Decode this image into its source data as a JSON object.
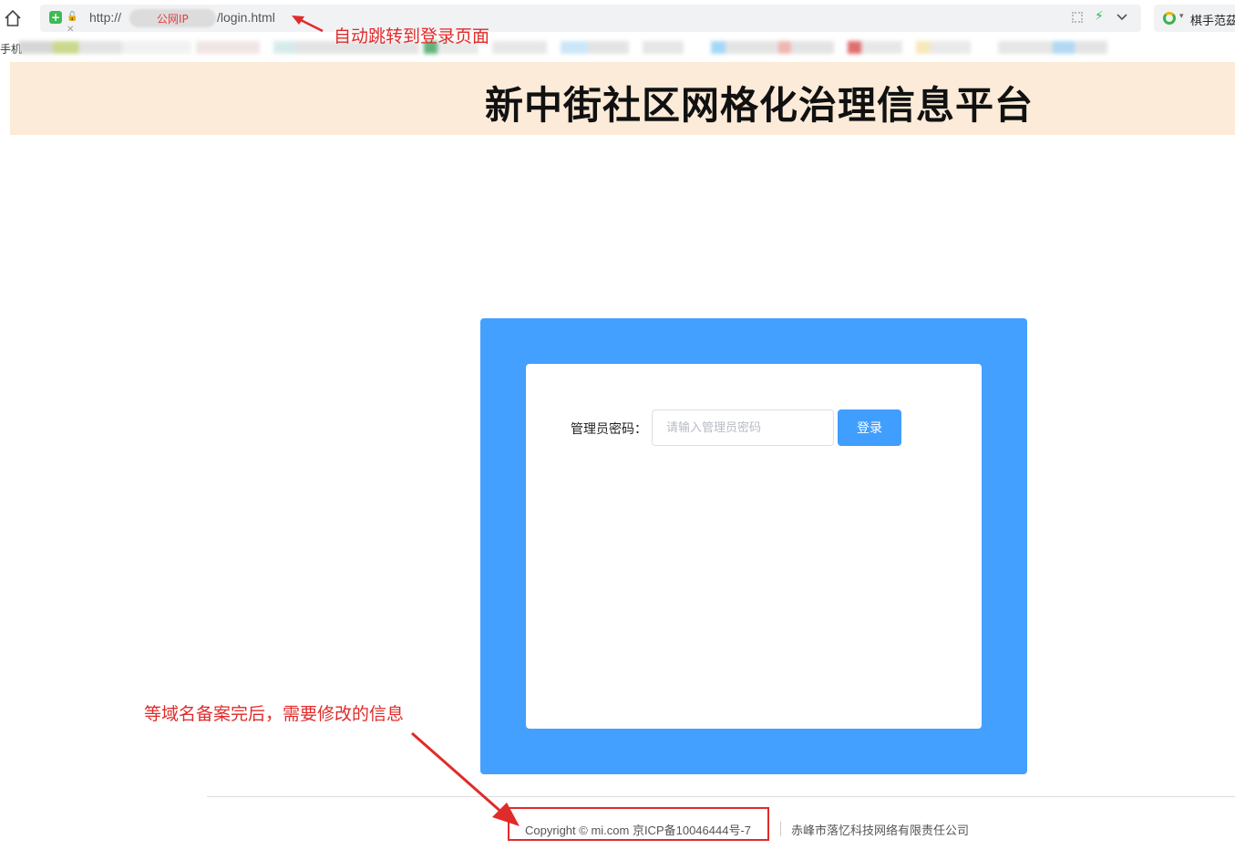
{
  "browser": {
    "url_scheme": "http://",
    "url_ip_label": "公网IP",
    "url_path": "/login.html",
    "search_engine_text": "棋手范茲",
    "bookmark_first_label": "手机"
  },
  "annotations": {
    "url_note": "自动跳转到登录页面",
    "footer_note": "等域名备案完后，需要修改的信息",
    "color": "#e02b2b"
  },
  "header": {
    "title": "新中街社区网格化治理信息平台",
    "background": "#fbebd8"
  },
  "login": {
    "password_label": "管理员密码：",
    "password_placeholder": "请输入管理员密码",
    "password_value": "",
    "submit_label": "登录",
    "frame_color": "#44a0ff",
    "button_color": "#409eff"
  },
  "footer": {
    "copyright": "Copyright © mi.com 京ICP备10046444号-7",
    "company": "赤峰市落忆科技网络有限责任公司"
  }
}
